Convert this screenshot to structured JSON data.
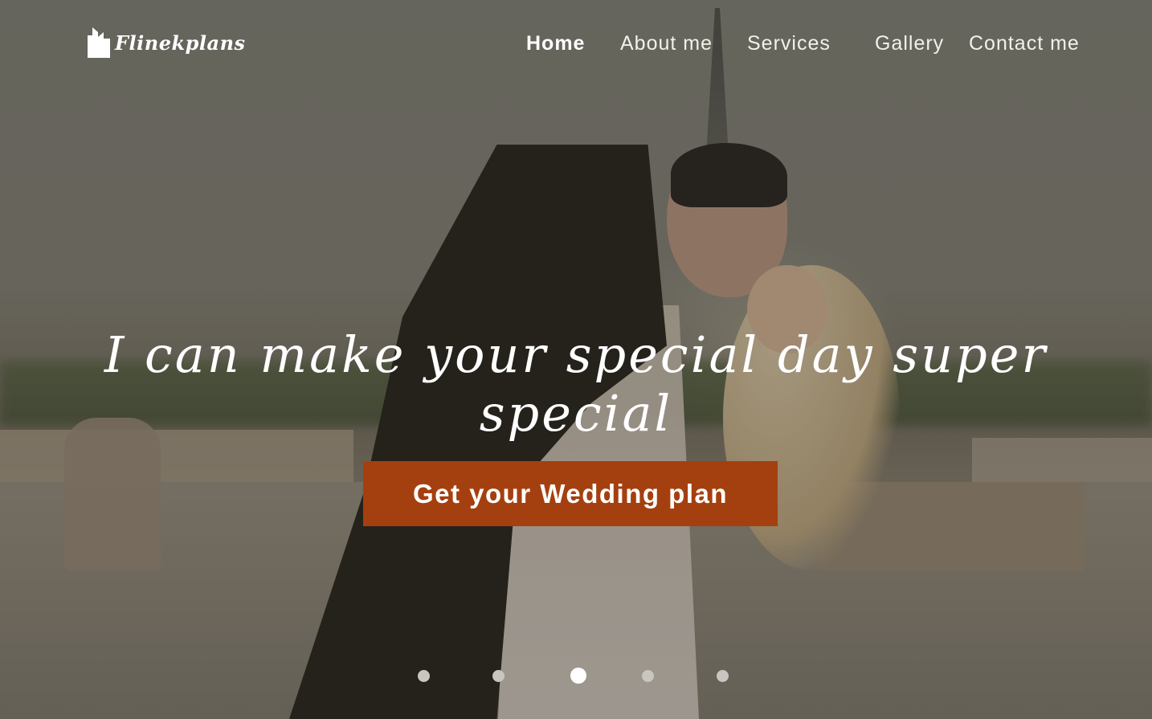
{
  "brand": {
    "name": "Flinekplans",
    "icon": "building-logo-icon"
  },
  "nav": {
    "items": [
      {
        "label": "Home",
        "active": true
      },
      {
        "label": "About me",
        "active": false
      },
      {
        "label": "Services",
        "active": false
      },
      {
        "label": "Gallery",
        "active": false
      },
      {
        "label": "Contact me",
        "active": false
      }
    ]
  },
  "hero": {
    "headline": "I can make your special day super special",
    "cta_label": "Get your Wedding plan",
    "image": "couple-kissing-wedding-photo"
  },
  "slider": {
    "count": 5,
    "active_index": 2
  },
  "colors": {
    "accent": "#a4400f",
    "text": "#ffffff",
    "dot_inactive": "#c9c6c0"
  }
}
